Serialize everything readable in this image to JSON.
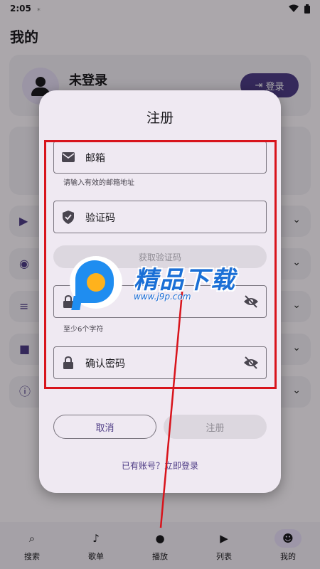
{
  "status_bar": {
    "time": "2:05"
  },
  "page": {
    "title": "我的"
  },
  "user_card": {
    "name": "未登录",
    "login_label": "登录"
  },
  "settings_rows": [
    {
      "icon": "play-circle-icon"
    },
    {
      "icon": "eye-icon"
    },
    {
      "icon": "playlist-icon"
    },
    {
      "icon": "folder-icon"
    },
    {
      "icon": "info-icon"
    }
  ],
  "bottom_nav": [
    {
      "label": "搜索",
      "icon": "search-icon"
    },
    {
      "label": "歌单",
      "icon": "album-icon"
    },
    {
      "label": "播放",
      "icon": "disc-icon"
    },
    {
      "label": "列表",
      "icon": "play-circle-icon"
    },
    {
      "label": "我的",
      "icon": "person-icon",
      "active": true
    }
  ],
  "dialog": {
    "title": "注册",
    "email": {
      "placeholder": "邮箱",
      "helper": "请输入有效的邮箱地址"
    },
    "code": {
      "placeholder": "验证码"
    },
    "get_code_label": "获取验证码",
    "password": {
      "placeholder": "密码",
      "helper": "至少6个字符"
    },
    "confirm_password": {
      "placeholder": "确认密码"
    },
    "cancel_label": "取消",
    "register_label": "注册",
    "have_account": "已有账号？立即登录"
  },
  "watermark": {
    "title": "精品下载",
    "url": "www.j9p.com"
  },
  "colors": {
    "accent": "#4f3d86",
    "annotation": "#d8141c",
    "watermark": "#1a6fd6"
  }
}
